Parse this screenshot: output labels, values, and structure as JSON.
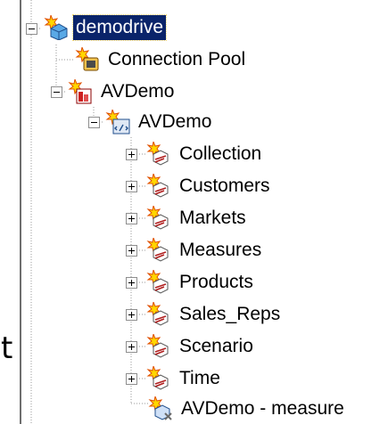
{
  "overlay_text": "t",
  "tree": {
    "nodes": [
      {
        "id": "demodrive",
        "label": "demodrive",
        "icon": "server-icon",
        "selected": true,
        "expander": "minus"
      },
      {
        "id": "connection-pool",
        "label": "Connection Pool",
        "icon": "connection-pool-icon",
        "expander": null
      },
      {
        "id": "avdemo-db",
        "label": "AVDemo",
        "icon": "database-icon",
        "expander": "minus"
      },
      {
        "id": "avdemo-cube",
        "label": "AVDemo",
        "icon": "cube-icon",
        "expander": "minus"
      },
      {
        "id": "collection",
        "label": "Collection",
        "icon": "dimension-icon",
        "expander": "plus"
      },
      {
        "id": "customers",
        "label": "Customers",
        "icon": "dimension-icon",
        "expander": "plus"
      },
      {
        "id": "markets",
        "label": "Markets",
        "icon": "dimension-icon",
        "expander": "plus"
      },
      {
        "id": "measures",
        "label": "Measures",
        "icon": "dimension-icon",
        "expander": "plus"
      },
      {
        "id": "products",
        "label": "Products",
        "icon": "dimension-icon",
        "expander": "plus"
      },
      {
        "id": "sales-reps",
        "label": "Sales_Reps",
        "icon": "dimension-icon",
        "expander": "plus"
      },
      {
        "id": "scenario",
        "label": "Scenario",
        "icon": "dimension-icon",
        "expander": "plus"
      },
      {
        "id": "time",
        "label": "Time",
        "icon": "dimension-icon",
        "expander": "plus"
      },
      {
        "id": "avdemo-measure",
        "label": "AVDemo - measure",
        "icon": "measure-icon",
        "expander": null
      }
    ]
  },
  "colors": {
    "selection": "#0a246a",
    "star": "#ffd700",
    "star_edge": "#e05000",
    "tree_line": "#9a9a9a"
  }
}
